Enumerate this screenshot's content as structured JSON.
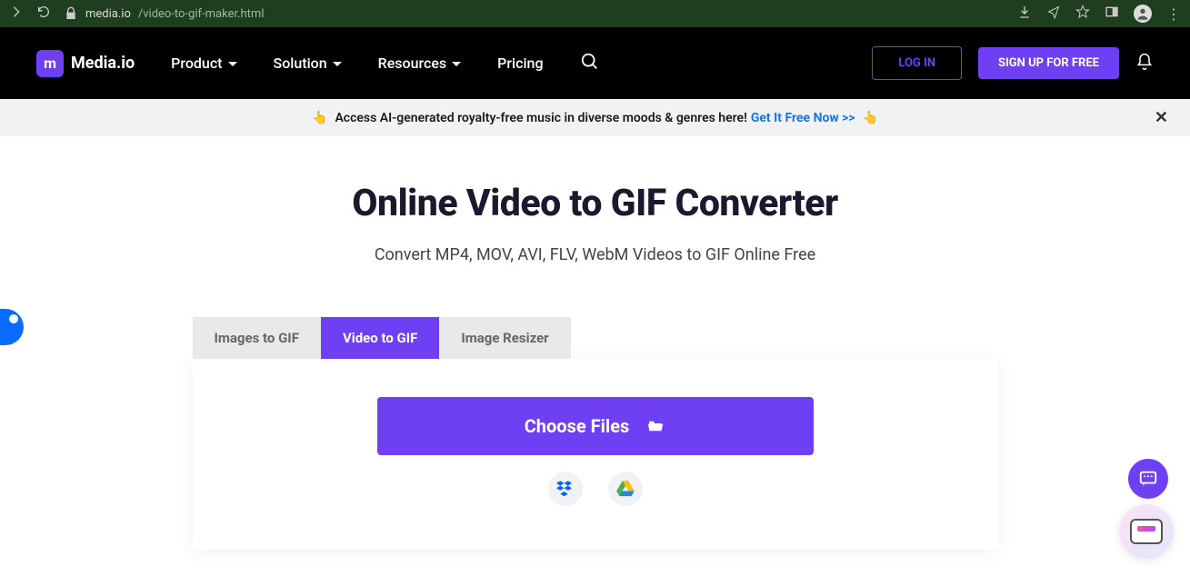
{
  "browser": {
    "url_host": "media.io",
    "url_path": "/video-to-gif-maker.html"
  },
  "header": {
    "brand": "Media.io",
    "nav": {
      "product": "Product",
      "solution": "Solution",
      "resources": "Resources",
      "pricing": "Pricing"
    },
    "login": "LOG IN",
    "signup": "SIGN UP FOR FREE"
  },
  "promo": {
    "text": "Access AI-generated royalty-free music in diverse moods & genres here!",
    "link": "Get It Free Now >>"
  },
  "page": {
    "title": "Online Video to GIF Converter",
    "subtitle": "Convert MP4, MOV, AVI, FLV, WebM Videos to GIF Online Free"
  },
  "tabs": {
    "images_to_gif": "Images to GIF",
    "video_to_gif": "Video to GIF",
    "image_resizer": "Image Resizer"
  },
  "upload": {
    "choose": "Choose Files"
  },
  "icons": {
    "dropbox": "dropbox-icon",
    "gdrive": "google-drive-icon"
  }
}
